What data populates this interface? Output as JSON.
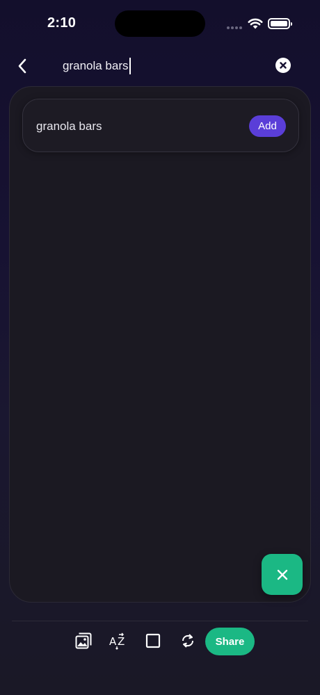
{
  "status_bar": {
    "time": "2:10",
    "icons": [
      "signal-icon",
      "wifi-icon",
      "battery-icon"
    ]
  },
  "search": {
    "value": "granola bars",
    "back_icon": "chevron-left-icon",
    "clear_icon": "close-circle-icon"
  },
  "suggestions": [
    {
      "label": "granola bars",
      "action_label": "Add"
    }
  ],
  "fab": {
    "icon": "close-icon"
  },
  "toolbar": {
    "items": [
      "image-icon",
      "sort-az-icon",
      "square-icon",
      "refresh-icon"
    ],
    "share_label": "Share"
  },
  "colors": {
    "accent_purple": "#5a3ed8",
    "accent_green": "#1bb884",
    "panel_bg": "#1b1922",
    "page_bg": "#171232"
  }
}
